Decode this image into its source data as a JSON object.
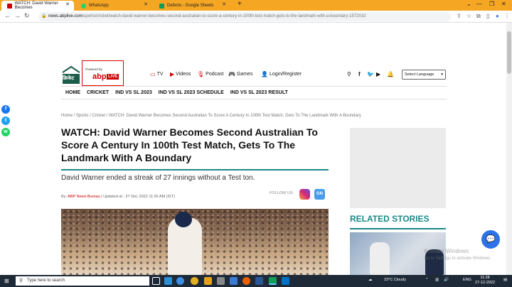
{
  "browser": {
    "tabs": [
      {
        "label": "WATCH: David Warner Becomes",
        "active": true,
        "favicon_color": "#cc0000"
      },
      {
        "label": "WhatsApp",
        "active": false,
        "favicon_color": "#25d366"
      },
      {
        "label": "Defects - Google Sheets",
        "active": false,
        "favicon_color": "#0f9d58"
      }
    ],
    "new_tab": "+",
    "url_host": "news.abplive.com",
    "url_path": "/sports/cricket/watch-david-warner-becomes-second-australian-to-score-a-century-in-100th-test-match-gets-to-the-landmark-with-a-boundary-1572032"
  },
  "site": {
    "logo_text": "क्रिकेट",
    "powered_by": "Powered by",
    "brand": "abp",
    "brand_live": "LIVE",
    "top_links": [
      {
        "label": "TV",
        "icon": "tv-icon"
      },
      {
        "label": "Videos",
        "icon": "video-icon"
      },
      {
        "label": "Podcast",
        "icon": "podcast-icon"
      },
      {
        "label": "Games",
        "icon": "gamepad-icon"
      },
      {
        "label": "Login/Register",
        "icon": "user-icon"
      }
    ],
    "language_select": "Select Language",
    "nav": [
      "HOME",
      "CRICKET",
      "IND VS SL 2023",
      "IND VS SL 2023 SCHEDULE",
      "IND VS SL 2023 RESULT"
    ]
  },
  "article": {
    "breadcrumb": "Home  /  Sports  /  Cricket  /  WATCH: David Warner Becomes Second Australian To Score A Century In 100th Test Match, Gets To The Landmark With A Boundary",
    "headline": "WATCH: David Warner Becomes Second Australian To Score A Century In 100th Test Match, Gets To The Landmark With A Boundary",
    "subheadline": "David Warner ended a streak of 27 innings without a Test ton.",
    "byline_prefix": "By: ",
    "author": "ABP News Bureau",
    "updated": " | Updated at : 27 Dec 2022 11:36 AM (IST)",
    "follow_us": "FOLLOW US:",
    "google_news": "GN"
  },
  "sidebar": {
    "related_title": "RELATED STORIES"
  },
  "watermark": {
    "line1": "Activate Windows",
    "line2": "Go to Settings to activate Windows."
  },
  "taskbar": {
    "search_placeholder": "Type here to search",
    "weather": "23°C  Cloudy",
    "lang": "ENG",
    "time": "11:28",
    "date": "27-12-2022"
  },
  "colors": {
    "accent": "#1a8a8a",
    "brand_red": "#cc0000",
    "chrome_tab_bar": "#f5a623"
  }
}
